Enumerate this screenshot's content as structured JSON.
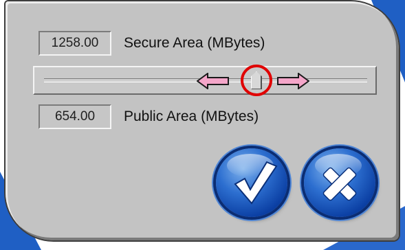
{
  "secure_area": {
    "value": "1258.00",
    "label": "Secure Area (MBytes)"
  },
  "public_area": {
    "value": "654.00",
    "label": "Public Area (MBytes)"
  },
  "slider": {
    "position_fraction": 0.66,
    "left_arrow_icon": "arrow-left-icon",
    "right_arrow_icon": "arrow-right-icon",
    "highlight_color": "#e00000",
    "arrow_color": "#f4a6c9"
  },
  "buttons": {
    "confirm_icon": "checkmark-icon",
    "cancel_icon": "close-icon",
    "color": "#1f5fc4"
  },
  "colors": {
    "panel": "#c3c3c3",
    "desktop": "#1f5fc4"
  }
}
